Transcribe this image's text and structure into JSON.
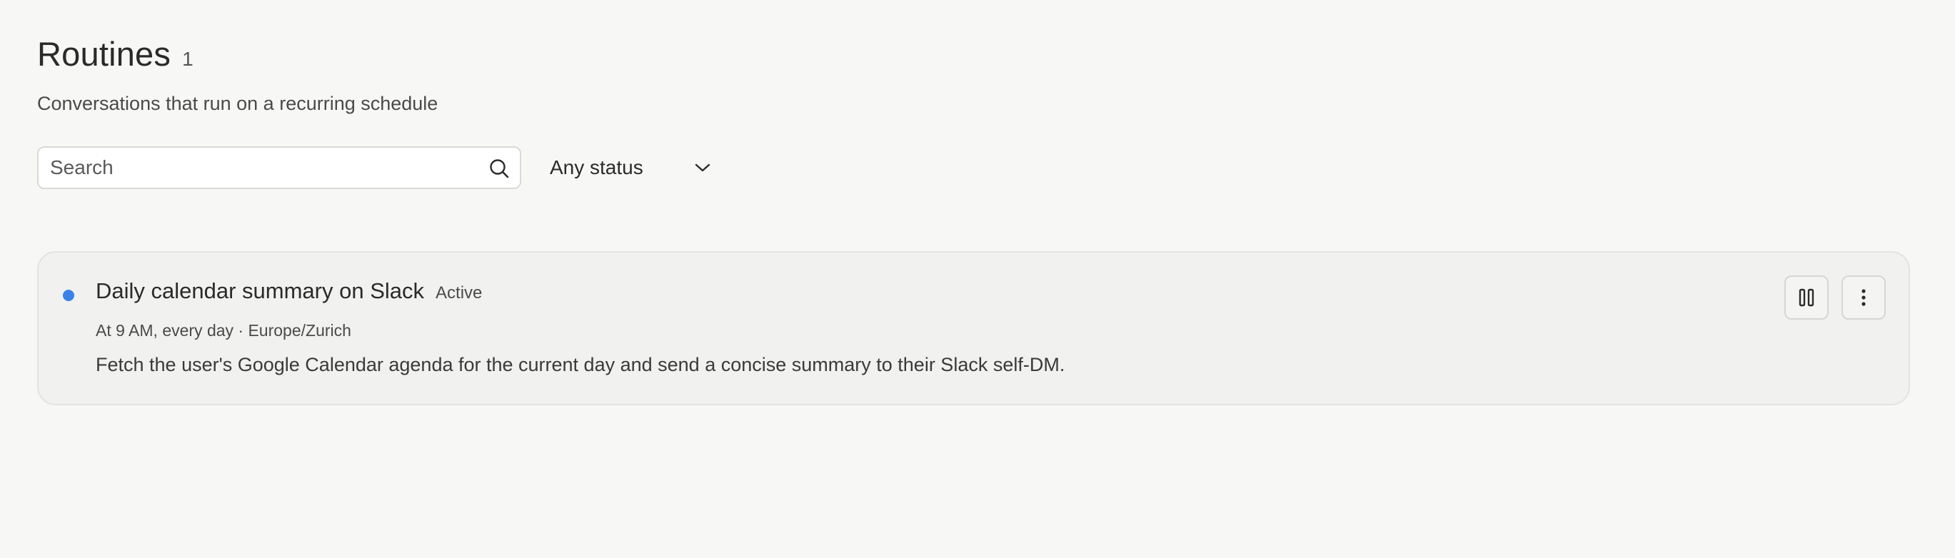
{
  "header": {
    "title": "Routines",
    "count": "1",
    "subtitle": "Conversations that run on a recurring schedule"
  },
  "filters": {
    "search_placeholder": "Search",
    "search_value": "",
    "status_selected": "Any status"
  },
  "routines": [
    {
      "title": "Daily calendar summary on Slack",
      "status": "Active",
      "status_color": "#3b82e8",
      "schedule": "At 9 AM, every day · Europe/Zurich",
      "description": "Fetch the user's Google Calendar agenda for the current day and send a concise summary to their Slack self-DM.",
      "actions": [
        "pause-icon",
        "more-vertical-icon"
      ]
    }
  ],
  "icons": {
    "search": "search-icon",
    "status_dropdown": "chevron-down-icon"
  }
}
